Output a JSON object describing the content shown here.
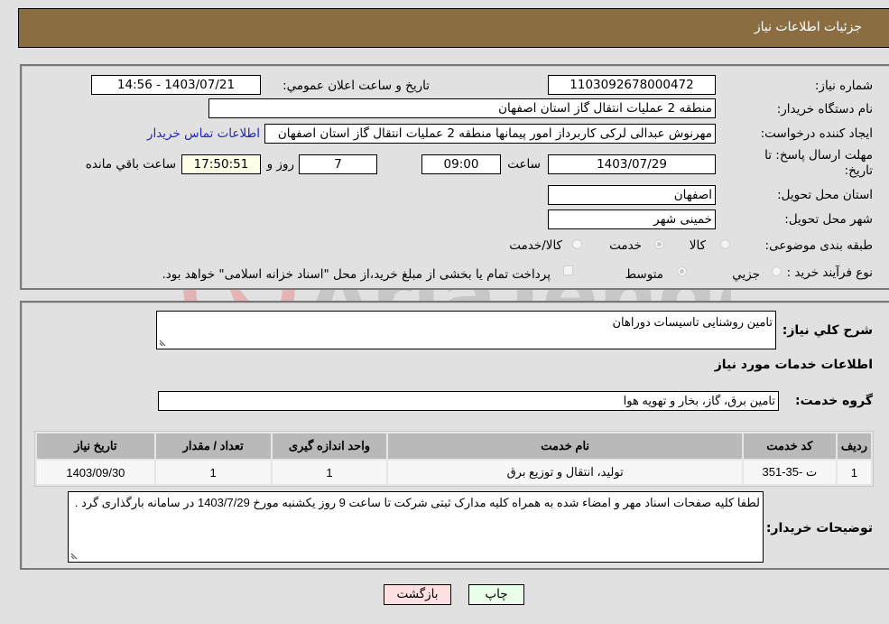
{
  "header": {
    "title": "جزئیات اطلاعات نیاز"
  },
  "form": {
    "need_number": {
      "label": "شماره نیاز:",
      "value": "1103092678000472"
    },
    "announce_datetime": {
      "label": "تاریخ و ساعت اعلان عمومي:",
      "value": "1403/07/21 - 14:56"
    },
    "buyer_org": {
      "label": "نام دستگاه خریدار:",
      "value": "منطقه 2 عملیات انتقال گاز استان اصفهان"
    },
    "requester": {
      "label": "ایجاد کننده درخواست:",
      "value": "مهرنوش عبدالی لرکی کاربرداز امور پیمانها منطقه 2 عملیات انتقال گاز استان اصفهان",
      "contact_link": "اطلاعات تماس خریدار"
    },
    "deadline": {
      "label": "مهلت ارسال پاسخ: تا تاریخ:",
      "date": "1403/07/29",
      "time_label": "ساعت",
      "time": "09:00",
      "days": "7",
      "days_label": "روز و",
      "remaining": "17:50:51",
      "remaining_label": "ساعت باقي مانده"
    },
    "delivery_province": {
      "label": "استان محل تحویل:",
      "value": "اصفهان"
    },
    "delivery_city": {
      "label": "شهر محل تحویل:",
      "value": "خمینی شهر"
    },
    "category": {
      "label": "طبقه بندی موضوعی:",
      "options": [
        "کالا",
        "خدمت",
        "کالا/خدمت"
      ],
      "selected": "خدمت"
    },
    "purchase_type": {
      "label": "نوع فرآیند خرید :",
      "options": [
        "جزيي",
        "متوسط"
      ],
      "selected": "متوسط",
      "treasury_note": "پرداخت تمام یا بخشی از مبلغ خرید،از محل \"اسناد خزانه اسلامی\" خواهد بود."
    }
  },
  "details": {
    "description_label": "شرح كلي نياز:",
    "description": "تامین روشنایی تاسیسات دوراهان",
    "services_title": "اطلاعات خدمات مورد نياز",
    "service_group_label": "گروه خدمت:",
    "service_group": "تامین برق، گاز، بخار و تهویه هوا",
    "table": {
      "columns": [
        "رديف",
        "كد خدمت",
        "نام خدمت",
        "واحد اندازه گيری",
        "تعداد / مقدار",
        "تاريخ نياز"
      ],
      "rows": [
        [
          "1",
          "ت -35-351",
          "تولید، انتقال و توزیع برق",
          "1",
          "1",
          "1403/09/30"
        ]
      ]
    },
    "buyer_notes_label": "توضیحات خریدار:",
    "buyer_notes": "لطفا کلیه صفحات اسناد مهر و امضاء شده به همراه کلیه مدارک ثبتی شرکت تا ساعت 9 روز یکشنبه مورخ 1403/7/29 در سامانه بارگذاری گرد ."
  },
  "buttons": {
    "print": "چاپ",
    "back": "بازگشت"
  },
  "watermark": {
    "text": "AriaTender.neT"
  },
  "colors": {
    "header_bg": "#8b6d42",
    "print_bg": "#eaffea",
    "back_bg": "#ffe0e0",
    "link": "#2222cc"
  }
}
